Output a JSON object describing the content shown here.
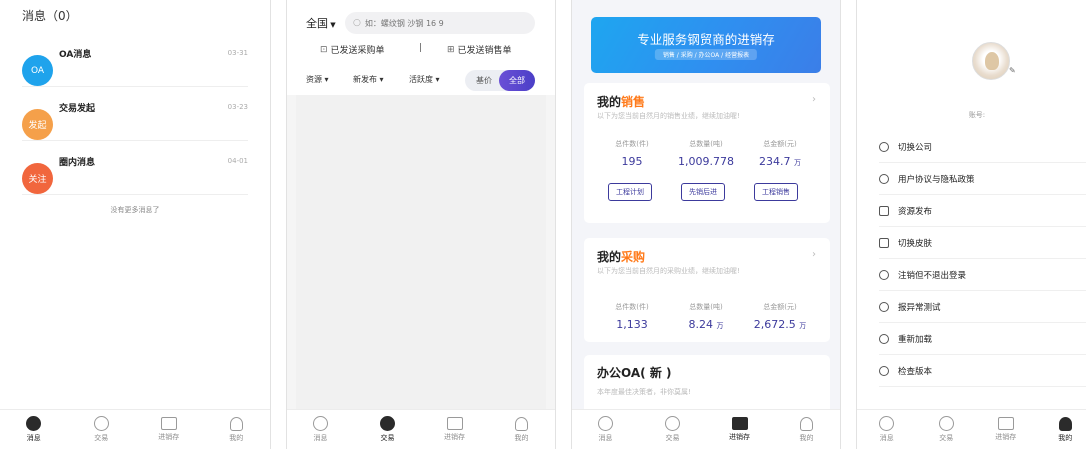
{
  "tabbar": [
    {
      "label": "消息",
      "icon": "chat-icon"
    },
    {
      "label": "交易",
      "icon": "exchange-icon"
    },
    {
      "label": "进销存",
      "icon": "inventory-icon"
    },
    {
      "label": "我的",
      "icon": "user-icon"
    }
  ],
  "messages": {
    "title": "消息（0）",
    "items": [
      {
        "avatar": "OA",
        "name": "OA消息",
        "time": "03-31",
        "color": "#1fa3ec"
      },
      {
        "avatar": "发起",
        "name": "交易发起",
        "time": "03-23",
        "color": "#f5a04a"
      },
      {
        "avatar": "关注",
        "name": "圈内消息",
        "time": "04-01",
        "color": "#f1663d"
      }
    ],
    "no_more": "没有更多消息了"
  },
  "trade": {
    "region": "全国",
    "search_placeholder": "如：螺纹钢 沙钢 16 9",
    "sent_purchase": "已发送采购单",
    "sent_sales": "已发送销售单",
    "filters": [
      "资源",
      "新发布",
      "活跃度"
    ],
    "toggle_base": "基价",
    "toggle_all": "全部"
  },
  "inventory": {
    "banner_title": "专业服务钢贸商的进销存",
    "banner_sub": "销售 / 采购 / 办公OA / 经营报表",
    "sales": {
      "title_a": "我的",
      "title_b": "销售",
      "subtitle": "以下为您当前自然月的销售业绩，继续加油喔!",
      "stats": [
        {
          "k": "总件数(件)",
          "v": "195",
          "u": ""
        },
        {
          "k": "总数量(吨)",
          "v": "1,009.778",
          "u": ""
        },
        {
          "k": "总金额(元)",
          "v": "234.7",
          "u": "万"
        }
      ],
      "buttons": [
        "工程计划",
        "先销后进",
        "工程销售"
      ]
    },
    "purchase": {
      "title_a": "我的",
      "title_b": "采购",
      "subtitle": "以下为您当前自然月的采购业绩，继续加油喔!",
      "stats": [
        {
          "k": "总件数(件)",
          "v": "1,133",
          "u": ""
        },
        {
          "k": "总数量(吨)",
          "v": "8.24",
          "u": "万"
        },
        {
          "k": "总金额(元)",
          "v": "2,672.5",
          "u": "万"
        }
      ]
    },
    "oa": {
      "title": "办公OA( 新 )",
      "subtitle": "本年度最佳决策者，非你莫属!"
    }
  },
  "profile": {
    "account_label": "账号:",
    "menu": [
      {
        "label": "切换公司",
        "icon": "switch-icon"
      },
      {
        "label": "用户协议与隐私政策",
        "icon": "info-icon"
      },
      {
        "label": "资源发布",
        "icon": "document-icon"
      },
      {
        "label": "切换皮肤",
        "icon": "shirt-icon"
      },
      {
        "label": "注销但不退出登录",
        "icon": "settings-icon"
      },
      {
        "label": "报异常测试",
        "icon": "settings-icon"
      },
      {
        "label": "重新加载",
        "icon": "info-icon"
      },
      {
        "label": "检查版本",
        "icon": "info-icon"
      }
    ]
  }
}
